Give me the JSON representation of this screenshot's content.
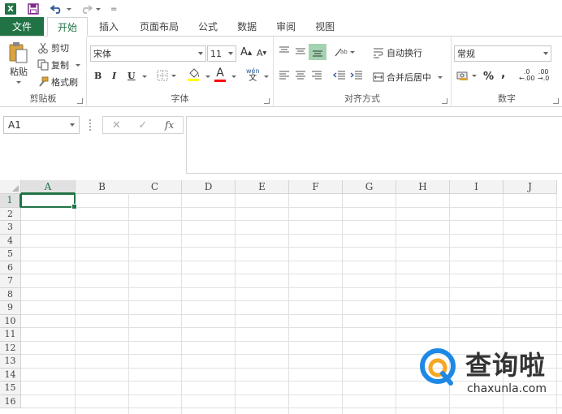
{
  "qat": {
    "app_icon_label": "X",
    "customize_label": "="
  },
  "tabs": [
    {
      "label": "文件"
    },
    {
      "label": "开始"
    },
    {
      "label": "插入"
    },
    {
      "label": "页面布局"
    },
    {
      "label": "公式"
    },
    {
      "label": "数据"
    },
    {
      "label": "审阅"
    },
    {
      "label": "视图"
    }
  ],
  "clipboard": {
    "paste_label": "粘贴",
    "cut_label": "剪切",
    "copy_label": "复制",
    "format_painter_label": "格式刷",
    "group_label": "剪贴板"
  },
  "font": {
    "family_value": "宋体",
    "size_value": "11",
    "grow_label": "A",
    "shrink_label": "A",
    "bold_label": "B",
    "italic_label": "I",
    "underline_label": "U",
    "font_color_label": "A",
    "phonetic_top": "wén",
    "phonetic_bottom": "文",
    "group_label": "字体",
    "fill_color": "#ffff00",
    "font_color": "#ff0000"
  },
  "alignment": {
    "wrap_text_label": "自动换行",
    "merge_center_label": "合并后居中",
    "group_label": "对齐方式"
  },
  "number": {
    "format_value": "常规",
    "percent_label": "%",
    "comma_label": ",",
    "inc_decimal_label": ".0",
    "dec_decimal_label": ".00",
    "group_label": "数字"
  },
  "formula_bar": {
    "name_box_value": "A1",
    "cancel_label": "✕",
    "enter_label": "✓",
    "fx_label": "fx"
  },
  "grid": {
    "columns": [
      "A",
      "B",
      "C",
      "D",
      "E",
      "F",
      "G",
      "H",
      "I",
      "J"
    ],
    "rows": [
      "1",
      "2",
      "3",
      "4",
      "5",
      "6",
      "7",
      "8",
      "9",
      "10",
      "11",
      "12",
      "13",
      "14",
      "15",
      "16"
    ],
    "active_cell": "A1"
  },
  "watermark": {
    "title": "查询啦",
    "subtitle": "chaxunla.com"
  },
  "colors": {
    "accent": "#217346",
    "watermark_blue": "#1e88e5",
    "watermark_orange": "#f5a623"
  }
}
